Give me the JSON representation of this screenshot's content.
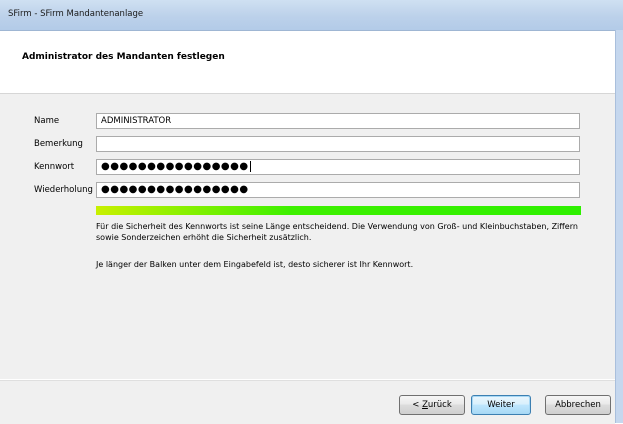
{
  "window": {
    "title": "SFirm - SFirm Mandantenanlage"
  },
  "header": {
    "heading": "Administrator des Mandanten festlegen"
  },
  "form": {
    "name_label": "Name",
    "name_value": "ADMINISTRATOR",
    "remark_label": "Bemerkung",
    "remark_value": "",
    "password_label": "Kennwort",
    "password_value": "●●●●●●●●●●●●●●●●",
    "repeat_label": "Wiederholung",
    "repeat_value": "●●●●●●●●●●●●●●●●",
    "strength_fraction": 1.0,
    "strength_color": "#2ef000"
  },
  "info": {
    "paragraph1": "Für die Sicherheit des Kennworts ist seine Länge entscheidend. Die Verwendung von Groß- und Kleinbuchstaben, Ziffern sowie Sonderzeichen erhöht die Sicherheit zusätzlich.",
    "paragraph2": "Je länger der Balken unter dem Eingabefeld ist, desto sicherer ist Ihr Kennwort."
  },
  "buttons": {
    "back_prefix": "< ",
    "back_mnemonic": "Z",
    "back_rest": "urück",
    "next": "Weiter",
    "cancel": "Abbrechen"
  }
}
